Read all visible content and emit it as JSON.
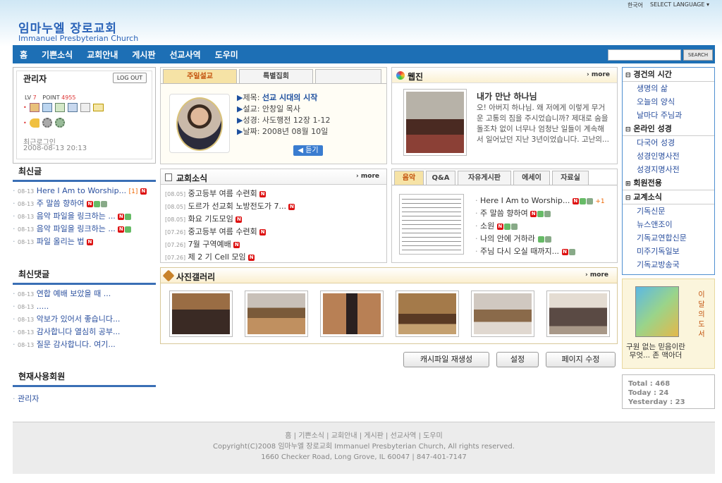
{
  "header": {
    "lang_korean": "한국어",
    "lang_select": "SELECT LANGUAGE",
    "logo_korean": "임마누엘 장로교회",
    "logo_english": "Immanuel Presbyterian Church",
    "search_button": "SEARCH",
    "search_value": ""
  },
  "nav": [
    "홈",
    "기쁜소식",
    "교회안내",
    "게시판",
    "선교사역",
    "도우미"
  ],
  "admin": {
    "title": "관리자",
    "logout": "LOG OUT",
    "lv_label": "LV",
    "lv_value": "7",
    "point_label": "POINT",
    "point_value": "4955",
    "last_login_label": "최근로그인",
    "last_login": "2008-08-13 20:13"
  },
  "recent_posts": {
    "title": "최신글",
    "items": [
      {
        "date": "08-13",
        "text": "Here I Am to Worship...",
        "count": "[1]"
      },
      {
        "date": "08-13",
        "text": "주 말씀 향하여",
        "count": ""
      },
      {
        "date": "08-13",
        "text": "음악 파일을 링크하는 ...",
        "count": ""
      },
      {
        "date": "08-13",
        "text": "음악 파일을 링크하는 ...",
        "count": ""
      },
      {
        "date": "08-13",
        "text": "파일 올리는 법",
        "count": ""
      }
    ]
  },
  "recent_comments": {
    "title": "최신댓글",
    "items": [
      {
        "date": "08-13",
        "text": "연합 예배 보았을 때 ..."
      },
      {
        "date": "08-13",
        "text": "....."
      },
      {
        "date": "08-13",
        "text": "악보가 있어서 좋습니다..."
      },
      {
        "date": "08-13",
        "text": "감사합니다 열심히 공부..."
      },
      {
        "date": "08-13",
        "text": "질문 감사합니다. 여기..."
      }
    ]
  },
  "members": {
    "title": "현재사용회원",
    "items": [
      "관리자"
    ]
  },
  "sermon": {
    "tabs": [
      "주일설교",
      "특별집회",
      ""
    ],
    "title_label": "제목:",
    "title": "선교 시대의 시작",
    "preacher": "설교: 안창일 목사",
    "scripture": "성경: 사도행전 12장 1-12",
    "date": "날짜: 2008년 08월 10일",
    "listen": "듣기"
  },
  "webzine": {
    "title": "웹진",
    "more": "more",
    "headline": "내가 만난 하나님",
    "body": "오! 아버지 하나님. 왜 저에게 이렇게 무거운 고통의 짐을 주시었습니까? 제대로 숨을 돌조차 없이 너무나 엄청난 일들이 계속해서 일어났던 지난 3년이었습니다. 고난의..."
  },
  "church_news": {
    "title": "교회소식",
    "more": "more",
    "items": [
      {
        "date": "[08.05]",
        "text": "중고등부 여름 수련회"
      },
      {
        "date": "[08.05]",
        "text": "도르가 선교회 노방전도가 7..."
      },
      {
        "date": "[08.05]",
        "text": "화요 기도모임"
      },
      {
        "date": "[07.26]",
        "text": "중고등부 여름 수련회"
      },
      {
        "date": "[07.26]",
        "text": "7월 구역예배"
      },
      {
        "date": "[07.26]",
        "text": "제 2 기 Cell 모임"
      }
    ]
  },
  "music": {
    "tabs": [
      "음악",
      "Q&A",
      "자유게시판",
      "에세이",
      "자료실"
    ],
    "items": [
      {
        "text": "Here I Am to Worship...",
        "extra": "+1"
      },
      {
        "text": "주 말씀 향하여",
        "extra": ""
      },
      {
        "text": "소원",
        "extra": ""
      },
      {
        "text": "나의 안에 거하라",
        "extra": ""
      },
      {
        "text": "주님 다시 오실 때까지...",
        "extra": ""
      }
    ]
  },
  "gallery": {
    "title": "사진갤러리",
    "more": "more"
  },
  "buttons": [
    "캐시파일 재생성",
    "설정",
    "페이지 수정"
  ],
  "sidebar": {
    "devotion_title": "경건의 시간",
    "devotion_items": [
      "생명의 삶",
      "오늘의 양식",
      "날마다 주님과"
    ],
    "bible_title": "온라인 성경",
    "bible_items": [
      "다국어 성경",
      "성경인명사전",
      "성경지명사전"
    ],
    "member_title": "회원전용",
    "news_title": "교계소식",
    "news_items": [
      "기독신문",
      "뉴스앤조이",
      "기독교연합신문",
      "미주기독일보",
      "기독교방송국"
    ]
  },
  "book": {
    "vertical": "이 달 의 도 서",
    "caption": "구원 없는 믿음이란 무엇... 존 맥아더"
  },
  "stats": {
    "total": "Total : 468",
    "today": "Today : 24",
    "yesterday": "Yesterday : 23"
  },
  "footer": {
    "links": "홈 | 기쁜소식 | 교회안내 | 게시판 | 선교사역 | 도우미",
    "copyright": "Copyright(C)2008 임마누엘 장로교회 Immanuel Presbyterian Church, All rights reserved.",
    "address": "1660 Checker Road, Long Grove, IL 60047 | 847-401-7147"
  }
}
